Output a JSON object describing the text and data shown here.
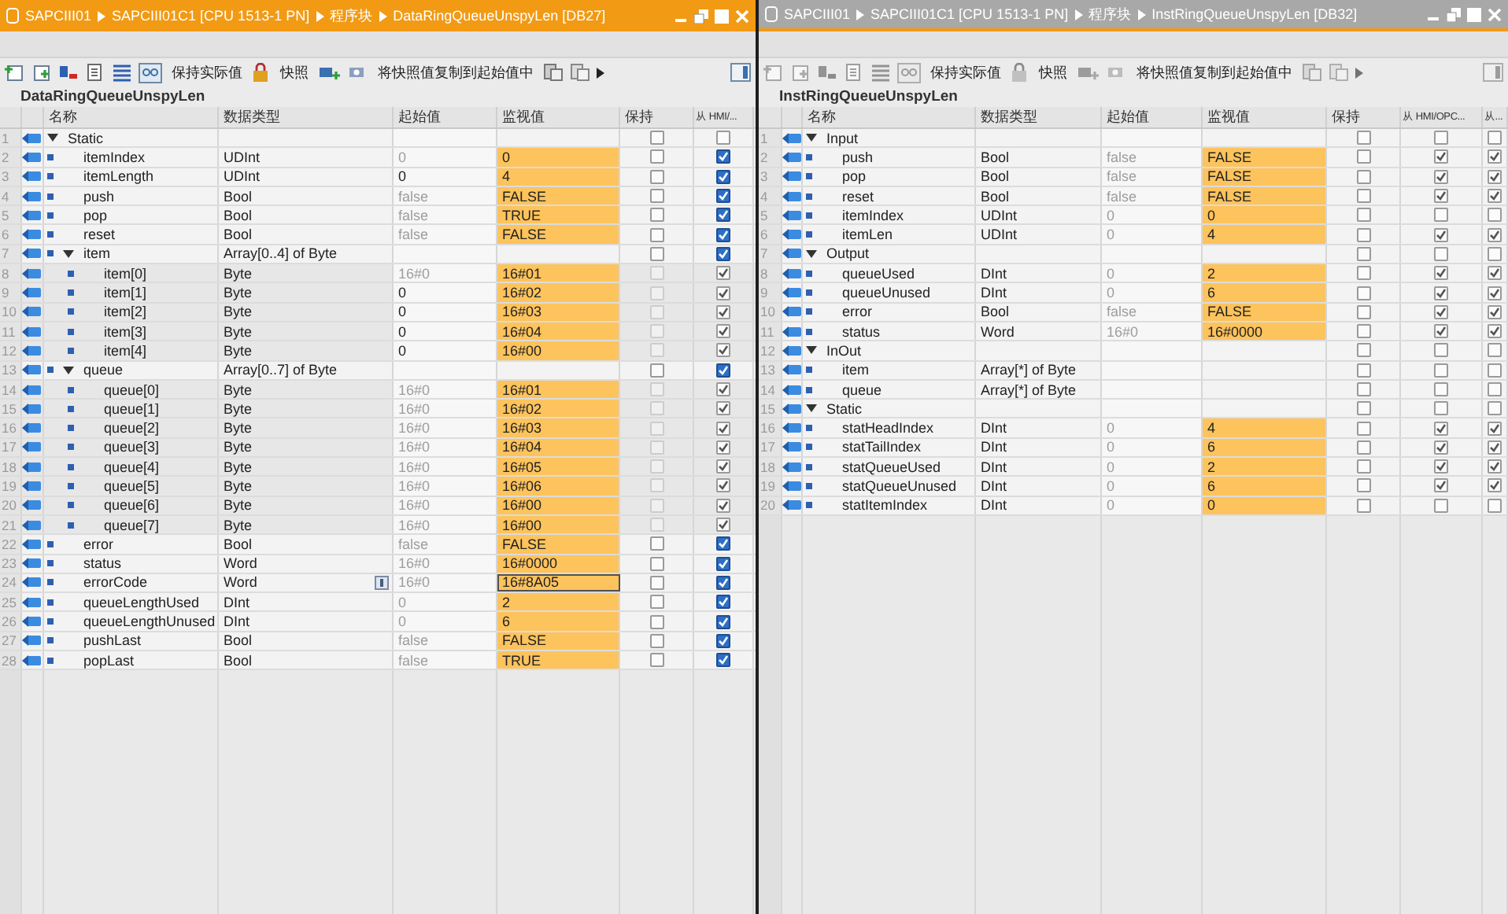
{
  "panes": [
    {
      "active": true,
      "breadcrumb": [
        "SAPCIII01",
        "SAPCIII01C1 [CPU 1513-1 PN]",
        "程序块",
        "DataRingQueueUnspyLen [DB27]"
      ],
      "toolbar": [
        "保持实际值",
        "快照",
        "将快照值复制到起始值中"
      ],
      "block_name": "DataRingQueueUnspyLen",
      "columns": [
        "名称",
        "数据类型",
        "起始值",
        "监视值",
        "保持",
        "从 HMI/..."
      ],
      "rows": [
        {
          "n": "1",
          "name": "Static",
          "expanded": true,
          "selected": false,
          "retain": false,
          "hmi": false,
          "children": [
            {
              "n": "2",
              "name": "itemIndex",
              "type": "UDInt",
              "start": "0",
              "monitor": "0",
              "selected": false,
              "retain": false,
              "hmi": true
            },
            {
              "n": "3",
              "name": "itemLength",
              "type": "UDInt",
              "start": "0",
              "start_set": true,
              "monitor": "4",
              "selected": false,
              "retain": false,
              "hmi": true
            },
            {
              "n": "4",
              "name": "push",
              "type": "Bool",
              "start": "false",
              "monitor": "FALSE",
              "selected": false,
              "retain": false,
              "hmi": true
            },
            {
              "n": "5",
              "name": "pop",
              "type": "Bool",
              "start": "false",
              "monitor": "TRUE",
              "selected": false,
              "retain": false,
              "hmi": true
            },
            {
              "n": "6",
              "name": "reset",
              "type": "Bool",
              "start": "false",
              "monitor": "FALSE",
              "selected": false,
              "retain": false,
              "hmi": true
            },
            {
              "n": "7",
              "name": "item",
              "type": "Array[0..4] of Byte",
              "expanded": true,
              "selected": false,
              "retain": false,
              "hmi": true,
              "children": [
                {
                  "n": "8",
                  "name": "item[0]",
                  "type": "Byte",
                  "start": "16#0",
                  "monitor": "16#01",
                  "locked": true,
                  "selected": false,
                  "retain": false,
                  "hmi": true
                },
                {
                  "n": "9",
                  "name": "item[1]",
                  "type": "Byte",
                  "start": "0",
                  "start_set": true,
                  "monitor": "16#02",
                  "locked": true,
                  "selected": false,
                  "retain": false,
                  "hmi": true
                },
                {
                  "n": "10",
                  "name": "item[2]",
                  "type": "Byte",
                  "start": "0",
                  "start_set": true,
                  "monitor": "16#03",
                  "locked": true,
                  "selected": false,
                  "retain": false,
                  "hmi": true
                },
                {
                  "n": "11",
                  "name": "item[3]",
                  "type": "Byte",
                  "start": "0",
                  "start_set": true,
                  "monitor": "16#04",
                  "locked": true,
                  "selected": false,
                  "retain": false,
                  "hmi": true
                },
                {
                  "n": "12",
                  "name": "item[4]",
                  "type": "Byte",
                  "start": "0",
                  "start_set": true,
                  "monitor": "16#00",
                  "locked": true,
                  "selected": false,
                  "retain": false,
                  "hmi": true
                }
              ]
            },
            {
              "n": "13",
              "name": "queue",
              "type": "Array[0..7] of Byte",
              "expanded": true,
              "selected": false,
              "retain": false,
              "hmi": true,
              "children": [
                {
                  "n": "14",
                  "name": "queue[0]",
                  "type": "Byte",
                  "start": "16#0",
                  "monitor": "16#01",
                  "locked": true,
                  "selected": false,
                  "retain": false,
                  "hmi": true
                },
                {
                  "n": "15",
                  "name": "queue[1]",
                  "type": "Byte",
                  "start": "16#0",
                  "monitor": "16#02",
                  "locked": true,
                  "selected": false,
                  "retain": false,
                  "hmi": true
                },
                {
                  "n": "16",
                  "name": "queue[2]",
                  "type": "Byte",
                  "start": "16#0",
                  "monitor": "16#03",
                  "locked": true,
                  "selected": false,
                  "retain": false,
                  "hmi": true
                },
                {
                  "n": "17",
                  "name": "queue[3]",
                  "type": "Byte",
                  "start": "16#0",
                  "monitor": "16#04",
                  "locked": true,
                  "selected": false,
                  "retain": false,
                  "hmi": true
                },
                {
                  "n": "18",
                  "name": "queue[4]",
                  "type": "Byte",
                  "start": "16#0",
                  "monitor": "16#05",
                  "locked": true,
                  "selected": false,
                  "retain": false,
                  "hmi": true
                },
                {
                  "n": "19",
                  "name": "queue[5]",
                  "type": "Byte",
                  "start": "16#0",
                  "monitor": "16#06",
                  "locked": true,
                  "selected": false,
                  "retain": false,
                  "hmi": true
                },
                {
                  "n": "20",
                  "name": "queue[6]",
                  "type": "Byte",
                  "start": "16#0",
                  "monitor": "16#00",
                  "locked": true,
                  "selected": false,
                  "retain": false,
                  "hmi": true
                },
                {
                  "n": "21",
                  "name": "queue[7]",
                  "type": "Byte",
                  "start": "16#0",
                  "monitor": "16#00",
                  "locked": true,
                  "selected": false,
                  "retain": false,
                  "hmi": true
                }
              ]
            },
            {
              "n": "22",
              "name": "error",
              "type": "Bool",
              "start": "false",
              "monitor": "FALSE",
              "selected": false,
              "retain": false,
              "hmi": true
            },
            {
              "n": "23",
              "name": "status",
              "type": "Word",
              "start": "16#0",
              "monitor": "16#0000",
              "selected": false,
              "retain": false,
              "hmi": true
            },
            {
              "n": "24",
              "name": "errorCode",
              "type": "Word",
              "start": "16#0",
              "monitor": "16#8A05",
              "selected": true,
              "retain": false,
              "hmi": true
            },
            {
              "n": "25",
              "name": "queueLengthUsed",
              "type": "DInt",
              "start": "0",
              "monitor": "2",
              "selected": false,
              "retain": false,
              "hmi": true
            },
            {
              "n": "26",
              "name": "queueLengthUnused",
              "type": "DInt",
              "start": "0",
              "monitor": "6",
              "selected": false,
              "retain": false,
              "hmi": true
            },
            {
              "n": "27",
              "name": "pushLast",
              "type": "Bool",
              "start": "false",
              "monitor": "FALSE",
              "selected": false,
              "retain": false,
              "hmi": true
            },
            {
              "n": "28",
              "name": "popLast",
              "type": "Bool",
              "start": "false",
              "monitor": "TRUE",
              "selected": false,
              "retain": false,
              "hmi": true
            }
          ]
        }
      ]
    },
    {
      "active": false,
      "breadcrumb": [
        "SAPCIII01",
        "SAPCIII01C1 [CPU 1513-1 PN]",
        "程序块",
        "InstRingQueueUnspyLen [DB32]"
      ],
      "toolbar": [
        "保持实际值",
        "快照",
        "将快照值复制到起始值中"
      ],
      "block_name": "InstRingQueueUnspyLen",
      "columns": [
        "名称",
        "数据类型",
        "起始值",
        "监视值",
        "保持",
        "从 HMI/OPC...",
        "从..."
      ],
      "rows": [
        {
          "n": "1",
          "name": "Input",
          "expanded": true,
          "selected": false,
          "retain": false,
          "hmi": false,
          "hmi2": false,
          "children": [
            {
              "n": "2",
              "name": "push",
              "type": "Bool",
              "start": "false",
              "monitor": "FALSE",
              "selected": false,
              "retain": false,
              "hmi": true,
              "hmi2": true
            },
            {
              "n": "3",
              "name": "pop",
              "type": "Bool",
              "start": "false",
              "monitor": "FALSE",
              "selected": false,
              "retain": false,
              "hmi": true,
              "hmi2": true
            },
            {
              "n": "4",
              "name": "reset",
              "type": "Bool",
              "start": "false",
              "monitor": "FALSE",
              "selected": false,
              "retain": false,
              "hmi": true,
              "hmi2": true
            },
            {
              "n": "5",
              "name": "itemIndex",
              "type": "UDInt",
              "start": "0",
              "monitor": "0",
              "selected": false,
              "retain": false,
              "hmi": false,
              "hmi2": false
            },
            {
              "n": "6",
              "name": "itemLen",
              "type": "UDInt",
              "start": "0",
              "monitor": "4",
              "selected": false,
              "retain": false,
              "hmi": true,
              "hmi2": true
            }
          ]
        },
        {
          "n": "7",
          "name": "Output",
          "expanded": true,
          "selected": false,
          "retain": false,
          "hmi": false,
          "hmi2": false,
          "children": [
            {
              "n": "8",
              "name": "queueUsed",
              "type": "DInt",
              "start": "0",
              "monitor": "2",
              "selected": false,
              "retain": false,
              "hmi": true,
              "hmi2": true
            },
            {
              "n": "9",
              "name": "queueUnused",
              "type": "DInt",
              "start": "0",
              "monitor": "6",
              "selected": false,
              "retain": false,
              "hmi": true,
              "hmi2": true
            },
            {
              "n": "10",
              "name": "error",
              "type": "Bool",
              "start": "false",
              "monitor": "FALSE",
              "selected": false,
              "retain": false,
              "hmi": true,
              "hmi2": true
            },
            {
              "n": "11",
              "name": "status",
              "type": "Word",
              "start": "16#0",
              "monitor": "16#0000",
              "selected": false,
              "retain": false,
              "hmi": true,
              "hmi2": true
            }
          ]
        },
        {
          "n": "12",
          "name": "InOut",
          "expanded": true,
          "selected": false,
          "retain": false,
          "hmi": false,
          "hmi2": false,
          "children": [
            {
              "n": "13",
              "name": "item",
              "type": "Array[*] of Byte",
              "selected": false,
              "retain": false,
              "hmi": false,
              "hmi2": false
            },
            {
              "n": "14",
              "name": "queue",
              "type": "Array[*] of Byte",
              "selected": false,
              "retain": false,
              "hmi": false,
              "hmi2": false
            }
          ]
        },
        {
          "n": "15",
          "name": "Static",
          "expanded": true,
          "selected": false,
          "retain": false,
          "hmi": false,
          "hmi2": false,
          "children": [
            {
              "n": "16",
              "name": "statHeadIndex",
              "type": "DInt",
              "start": "0",
              "monitor": "4",
              "selected": false,
              "retain": false,
              "hmi": true,
              "hmi2": true
            },
            {
              "n": "17",
              "name": "statTailIndex",
              "type": "DInt",
              "start": "0",
              "monitor": "6",
              "selected": false,
              "retain": false,
              "hmi": true,
              "hmi2": true
            },
            {
              "n": "18",
              "name": "statQueueUsed",
              "type": "DInt",
              "start": "0",
              "monitor": "2",
              "selected": false,
              "retain": false,
              "hmi": true,
              "hmi2": true
            },
            {
              "n": "19",
              "name": "statQueueUnused",
              "type": "DInt",
              "start": "0",
              "monitor": "6",
              "selected": false,
              "retain": false,
              "hmi": true,
              "hmi2": true
            },
            {
              "n": "20",
              "name": "statItemIndex",
              "type": "DInt",
              "start": "0",
              "monitor": "0",
              "selected": false,
              "retain": false,
              "hmi": false,
              "hmi2": false
            }
          ]
        }
      ]
    }
  ]
}
